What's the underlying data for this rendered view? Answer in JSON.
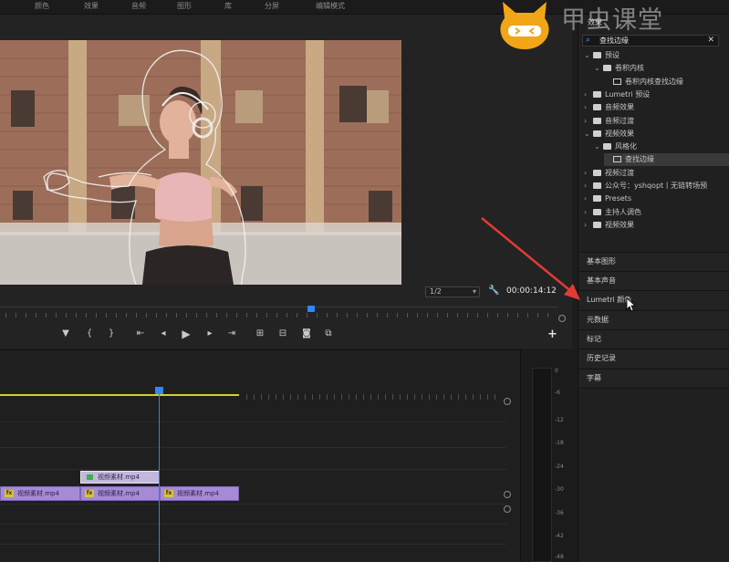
{
  "menu": [
    "颜色",
    "效果",
    "音频",
    "图形",
    "库",
    "分屏",
    "编辑模式"
  ],
  "watermark": {
    "text": "甲虫课堂"
  },
  "monitor": {
    "zoom": "1/2",
    "timecode": "00:00:14:12"
  },
  "timeline": {
    "clips": [
      {
        "label": "视频素材.mp4"
      },
      {
        "label": "视频素材.mp4"
      },
      {
        "label": "视频素材.mp4"
      }
    ],
    "upper_clip": "视频素材.mp4"
  },
  "meter": {
    "levels": [
      "0",
      "-6",
      "-12",
      "-18",
      "-24",
      "-30",
      "-36",
      "-42",
      "-48"
    ]
  },
  "effects": {
    "title": "效果",
    "search": "查找边缘",
    "tree": [
      {
        "label": "预设",
        "indent": 0,
        "expanded": true,
        "icon": "folder"
      },
      {
        "label": "卷积内核",
        "indent": 1,
        "expanded": true,
        "icon": "folder"
      },
      {
        "label": "卷积内核查找边缘",
        "indent": 2,
        "expanded": false,
        "icon": "fx"
      },
      {
        "label": "Lumetri 预设",
        "indent": 0,
        "expanded": false,
        "icon": "folder"
      },
      {
        "label": "音频效果",
        "indent": 0,
        "expanded": false,
        "icon": "folder"
      },
      {
        "label": "音频过渡",
        "indent": 0,
        "expanded": false,
        "icon": "folder"
      },
      {
        "label": "视频效果",
        "indent": 0,
        "expanded": true,
        "icon": "folder"
      },
      {
        "label": "风格化",
        "indent": 1,
        "expanded": true,
        "icon": "folder"
      },
      {
        "label": "查找边缘",
        "indent": 2,
        "expanded": false,
        "icon": "fx",
        "selected": true
      },
      {
        "label": "视频过渡",
        "indent": 0,
        "expanded": false,
        "icon": "folder"
      },
      {
        "label": "公众号：yshqopt丨无链转场预",
        "indent": 0,
        "expanded": false,
        "icon": "folder"
      },
      {
        "label": "Presets",
        "indent": 0,
        "expanded": false,
        "icon": "folder"
      },
      {
        "label": "主持人调色",
        "indent": 0,
        "expanded": false,
        "icon": "folder"
      },
      {
        "label": "视频效果",
        "indent": 0,
        "expanded": false,
        "icon": "folder"
      }
    ]
  },
  "sections": [
    "基本图形",
    "基本声音",
    "Lumetri 颜色",
    "元数据",
    "标记",
    "历史记录",
    "字幕"
  ],
  "colors": {
    "accent": "#2f87ff",
    "clip": "#a58bd6",
    "work_area": "#d4cf2e",
    "annotation_arrow": "#e23b35"
  }
}
